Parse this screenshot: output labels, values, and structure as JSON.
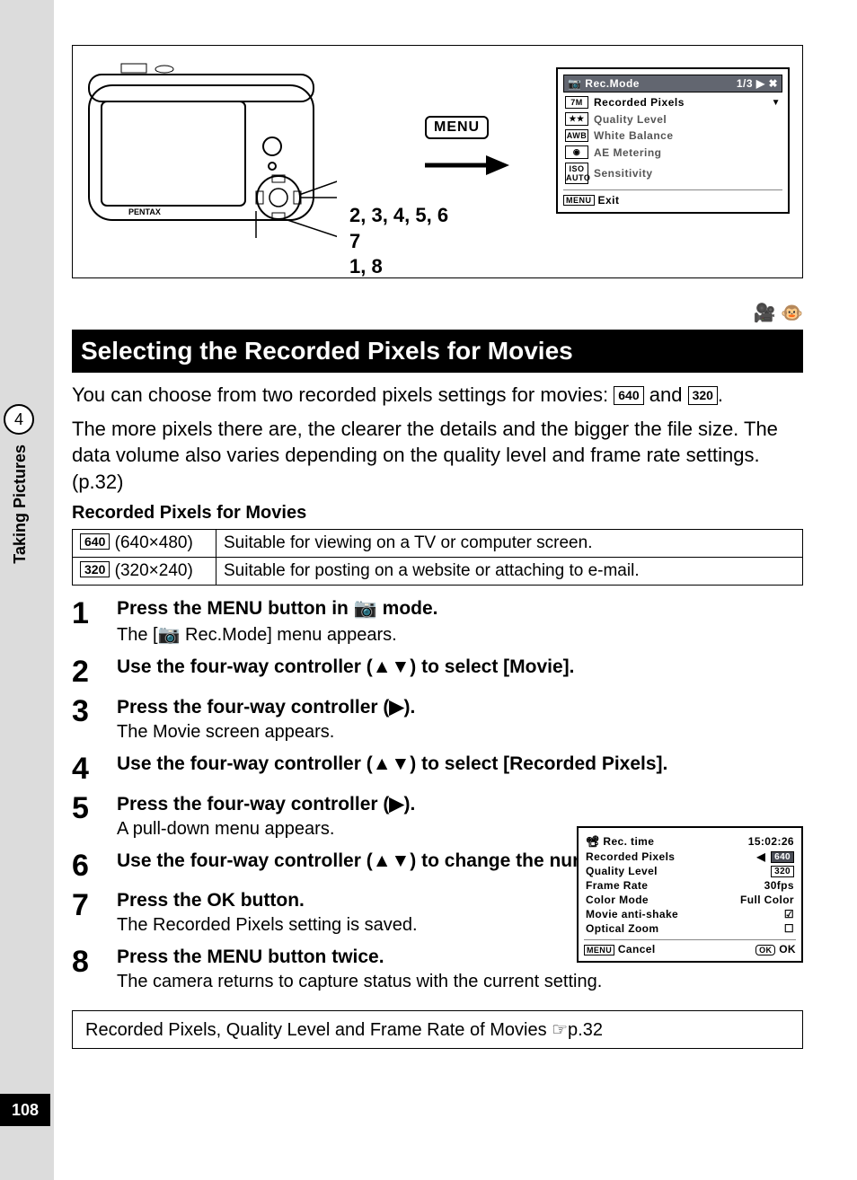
{
  "side": {
    "chapter_num": "4",
    "side_label": "Taking Pictures",
    "page_num": "108"
  },
  "figure": {
    "menu_button_label": "MENU",
    "step_refs_l1": "2, 3, 4, 5, 6",
    "step_refs_l2": "7",
    "step_refs_l3": "1, 8",
    "menu": {
      "header_title": "Rec.Mode",
      "header_page": "1/3",
      "rows": [
        {
          "icon": "7M",
          "label": "Recorded Pixels"
        },
        {
          "icon": "★★",
          "label": "Quality Level"
        },
        {
          "icon": "AWB",
          "label": "White Balance"
        },
        {
          "icon": "◉",
          "label": "AE Metering"
        },
        {
          "icon": "ISO AUTO",
          "label": "Sensitivity"
        }
      ],
      "exit": "Exit",
      "menu_btn": "MENU"
    }
  },
  "title": "Selecting the Recorded Pixels for Movies",
  "intro": {
    "p1a": "You can choose from two recorded pixels settings for movies: ",
    "box640": "640",
    "p1b": " and ",
    "box320": "320",
    "p1c": ".",
    "p2": "The more pixels there are, the clearer the details and the bigger the file size. The data volume also varies depending on the quality level and frame rate settings. (p.32)"
  },
  "table": {
    "heading": "Recorded Pixels for Movies",
    "rows": [
      {
        "spec_icon": "640",
        "spec_res": "(640×480)",
        "desc": "Suitable for viewing on a TV or computer screen."
      },
      {
        "spec_icon": "320",
        "spec_res": "(320×240)",
        "desc": "Suitable for posting on a website or attaching to e-mail."
      }
    ]
  },
  "steps": [
    {
      "n": "1",
      "line": "Press the MENU button in 📷 mode.",
      "sub": "The [📷 Rec.Mode] menu appears."
    },
    {
      "n": "2",
      "line": "Use the four-way controller (▲▼) to select [Movie].",
      "sub": ""
    },
    {
      "n": "3",
      "line": "Press the four-way controller (▶).",
      "sub": "The Movie screen appears."
    },
    {
      "n": "4",
      "line": "Use the four-way controller (▲▼) to select [Recorded Pixels].",
      "sub": ""
    },
    {
      "n": "5",
      "line": "Press the four-way controller (▶).",
      "sub": "A pull-down menu appears."
    },
    {
      "n": "6",
      "line": "Use the four-way controller (▲▼) to change the number of recorded pixels.",
      "sub": ""
    },
    {
      "n": "7",
      "line": "Press the OK button.",
      "sub": "The Recorded Pixels setting is saved."
    },
    {
      "n": "8",
      "line": "Press the MENU button twice.",
      "sub": "The camera returns to capture status with the current setting."
    }
  ],
  "movie_screen": {
    "hdr_left": "Rec. time",
    "hdr_right": "15:02:26",
    "rows": [
      {
        "label": "Recorded Pixels",
        "val": "640",
        "sel": true,
        "arrow": true
      },
      {
        "label": "Quality Level",
        "val": "320",
        "box": true
      },
      {
        "label": "Frame Rate",
        "val": "30fps"
      },
      {
        "label": "Color Mode",
        "val": "Full Color"
      },
      {
        "label": "Movie anti-shake",
        "val": "☑"
      },
      {
        "label": "Optical Zoom",
        "val": "☐"
      }
    ],
    "cancel": "Cancel",
    "ok": "OK",
    "menu_btn": "MENU",
    "ok_btn": "OK"
  },
  "xref": "Recorded Pixels, Quality Level and Frame Rate of Movies ☞p.32"
}
